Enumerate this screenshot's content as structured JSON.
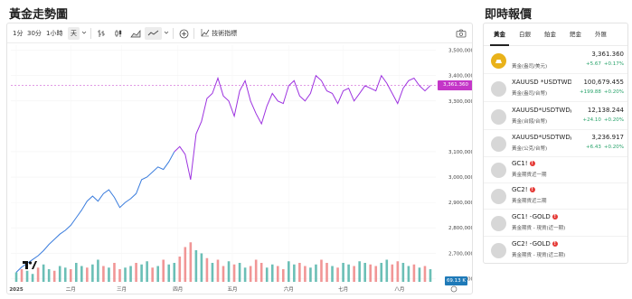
{
  "headings": {
    "chart_title": "黃金走勢圖",
    "quotes_title": "即時報價"
  },
  "toolbar": {
    "intervals": [
      "1分",
      "30分",
      "1小時",
      "天"
    ],
    "active_interval": "天",
    "indicators_label": "技術指標"
  },
  "chart_data": {
    "type": "line",
    "x": [
      "2025-01-02",
      "2025-01-05",
      "2025-01-08",
      "2025-01-11",
      "2025-01-14",
      "2025-01-17",
      "2025-01-20",
      "2025-01-23",
      "2025-01-26",
      "2025-01-29",
      "2025-02-01",
      "2025-02-04",
      "2025-02-07",
      "2025-02-10",
      "2025-02-13",
      "2025-02-16",
      "2025-02-19",
      "2025-02-22",
      "2025-02-25",
      "2025-02-28",
      "2025-03-03",
      "2025-03-06",
      "2025-03-09",
      "2025-03-12",
      "2025-03-15",
      "2025-03-18",
      "2025-03-21",
      "2025-03-24",
      "2025-03-27",
      "2025-03-30",
      "2025-04-02",
      "2025-04-05",
      "2025-04-08",
      "2025-04-11",
      "2025-04-14",
      "2025-04-17",
      "2025-04-20",
      "2025-04-23",
      "2025-04-26",
      "2025-04-29",
      "2025-05-02",
      "2025-05-05",
      "2025-05-08",
      "2025-05-11",
      "2025-05-14",
      "2025-05-17",
      "2025-05-20",
      "2025-05-23",
      "2025-05-26",
      "2025-05-29",
      "2025-06-01",
      "2025-06-04",
      "2025-06-07",
      "2025-06-10",
      "2025-06-13",
      "2025-06-16",
      "2025-06-19",
      "2025-06-22",
      "2025-06-25",
      "2025-06-28",
      "2025-07-01",
      "2025-07-04",
      "2025-07-07",
      "2025-07-10",
      "2025-07-13",
      "2025-07-16",
      "2025-07-19",
      "2025-07-22",
      "2025-07-25",
      "2025-07-28",
      "2025-07-31",
      "2025-08-03",
      "2025-08-06",
      "2025-08-09",
      "2025-08-12",
      "2025-08-15",
      "2025-08-18"
    ],
    "series": [
      {
        "values": [
          2625,
          2645,
          2660,
          2675,
          2690,
          2710,
          2735,
          2755,
          2775,
          2790,
          2810,
          2840,
          2870,
          2905,
          2925,
          2905,
          2935,
          2950,
          2920,
          2880,
          2900,
          2915,
          2935,
          2990,
          3000,
          3020,
          3040,
          3030,
          3060,
          3100,
          3120,
          3090,
          2990,
          3170,
          3220,
          3310,
          3330,
          3390,
          3320,
          3300,
          3240,
          3340,
          3380,
          3300,
          3250,
          3210,
          3280,
          3330,
          3300,
          3290,
          3360,
          3380,
          3320,
          3300,
          3330,
          3400,
          3380,
          3340,
          3330,
          3290,
          3340,
          3350,
          3300,
          3330,
          3360,
          3350,
          3340,
          3400,
          3370,
          3330,
          3290,
          3350,
          3380,
          3390,
          3360,
          3340,
          3361
        ]
      }
    ],
    "volume_up": [
      6,
      8,
      7,
      5,
      9,
      11,
      8,
      7,
      10,
      9,
      8,
      12,
      10,
      9,
      11,
      14,
      10,
      9,
      12,
      8,
      9,
      10,
      12,
      11,
      13,
      9,
      10,
      14,
      11,
      12,
      16,
      22,
      25,
      20,
      18,
      15,
      12,
      14,
      10,
      13,
      11,
      12,
      9,
      10,
      14,
      12,
      9,
      11,
      10,
      8,
      13,
      11,
      12,
      10,
      9,
      11,
      14,
      12,
      10,
      9,
      12,
      11,
      10,
      13,
      12,
      11,
      10,
      12,
      14,
      11,
      13,
      12,
      10,
      11,
      9,
      10,
      8
    ],
    "volume_down": [
      false,
      true,
      false,
      false,
      true,
      false,
      false,
      true,
      false,
      false,
      true,
      false,
      false,
      true,
      false,
      false,
      true,
      false,
      true,
      true,
      false,
      false,
      true,
      false,
      false,
      true,
      false,
      true,
      false,
      false,
      true,
      true,
      true,
      false,
      false,
      true,
      false,
      true,
      true,
      false,
      true,
      false,
      false,
      true,
      true,
      true,
      false,
      false,
      true,
      true,
      false,
      false,
      true,
      true,
      false,
      false,
      true,
      true,
      false,
      true,
      false,
      false,
      true,
      false,
      false,
      true,
      true,
      false,
      false,
      true,
      true,
      false,
      false,
      true,
      false,
      true,
      false
    ],
    "y_ticks": [
      "3,500,000",
      "3,400,000",
      "3,300,000",
      "3,100,000",
      "3,000,000",
      "2,900,000",
      "2,800,000",
      "2,700,000",
      "2,600,000"
    ],
    "y_tick_values": [
      3500,
      3400,
      3300,
      3100,
      3000,
      2900,
      2800,
      2700,
      2600
    ],
    "x_ticks": [
      "2025",
      "二月",
      "三月",
      "四月",
      "五月",
      "六月",
      "七月",
      "八月"
    ],
    "x_tick_dates": [
      "2025-01-02",
      "2025-02-01",
      "2025-03-01",
      "2025-04-01",
      "2025-05-01",
      "2025-06-01",
      "2025-07-01",
      "2025-08-01"
    ],
    "ylim": [
      2580,
      3520
    ],
    "last_price_label": "3,361.360",
    "volume_label": "69.13 K",
    "colors": {
      "line_early": "#3b7ddd",
      "line_late": "#9d33e0",
      "vol_up": "#5bb8ae",
      "vol_down": "#ef8b8b",
      "price_tag": "#c436c8"
    }
  },
  "quote_tabs": [
    "黃金",
    "白銀",
    "鉑金",
    "鈀金",
    "外匯"
  ],
  "active_quote_tab": "黃金",
  "quotes": [
    {
      "symbol": "",
      "desc": "黃金(盎司/美元)",
      "price": "3,361.360",
      "change": "+5.67",
      "pct": "+0.17%",
      "icon": "gold-bar-icon"
    },
    {
      "symbol": "XAUUSD *USDTWD",
      "desc": "黃金(盎司/台幣)",
      "price": "100,679.455",
      "change": "+199.88",
      "pct": "+0.20%",
      "icon": "gold-coin-icon"
    },
    {
      "symbol": "XAUUSD*USDTWD/",
      "desc": "黃金(台錢/台幣)",
      "price": "12,138.244",
      "change": "+24.10",
      "pct": "+0.20%",
      "icon": "gold-coin-icon"
    },
    {
      "symbol": "XAUUSD*USDTWD/3",
      "desc": "黃金(公克/台幣)",
      "price": "3,236.917",
      "change": "+6.43",
      "pct": "+0.20%",
      "icon": "gold-coin-icon"
    },
    {
      "symbol": "GC1!",
      "desc": "黃金期貨近一期",
      "price": "",
      "change": "",
      "pct": "",
      "icon": "futures-icon"
    },
    {
      "symbol": "GC2!",
      "desc": "黃金期貨近二期",
      "price": "",
      "change": "",
      "pct": "",
      "icon": "futures-icon"
    },
    {
      "symbol": "GC1! -GOLD",
      "desc": "黃金期貨 - 現貨(近一期)",
      "price": "",
      "change": "",
      "pct": "",
      "icon": "futures-icon"
    },
    {
      "symbol": "GC2! -GOLD",
      "desc": "黃金期貨 - 現貨(近二期)",
      "price": "",
      "change": "",
      "pct": "",
      "icon": "futures-icon"
    }
  ]
}
